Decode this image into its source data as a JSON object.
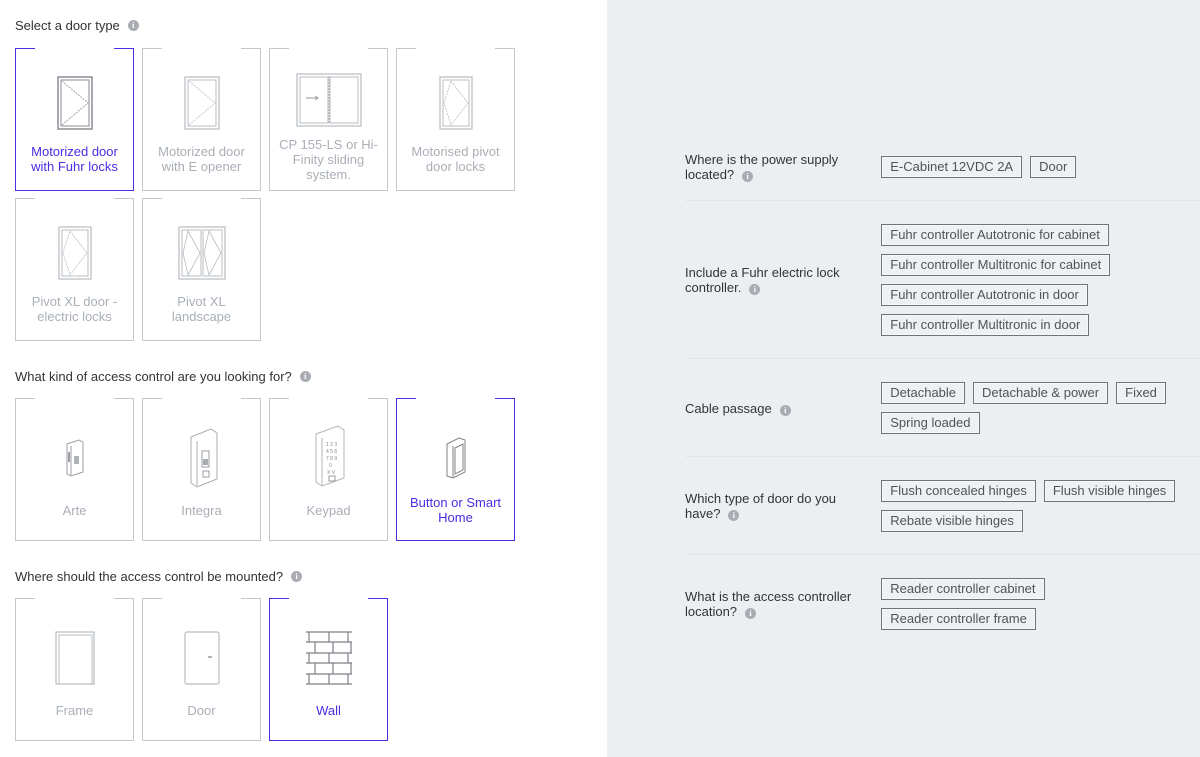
{
  "accent_color": "#4a2de3",
  "left": {
    "door_type": {
      "title": "Select a door type",
      "options": [
        {
          "label": "Motorized door with Fuhr locks",
          "icon": "door-single-icon",
          "selected": true
        },
        {
          "label": "Motorized door with E opener",
          "icon": "door-single-icon",
          "selected": false
        },
        {
          "label": "CP 155-LS or Hi-Finity sliding system.",
          "icon": "sliding-door-icon",
          "selected": false
        },
        {
          "label": "Motorised pivot door locks",
          "icon": "pivot-door-icon",
          "selected": false
        },
        {
          "label": "Pivot XL door - electric locks",
          "icon": "pivot-door-icon",
          "selected": false
        },
        {
          "label": "Pivot XL landscape",
          "icon": "double-pivot-door-icon",
          "selected": false
        }
      ]
    },
    "access_control": {
      "title": "What kind of access control are you looking for?",
      "options": [
        {
          "label": "Arte",
          "icon": "arte-reader-icon",
          "selected": false
        },
        {
          "label": "Integra",
          "icon": "integra-reader-icon",
          "selected": false
        },
        {
          "label": "Keypad",
          "icon": "keypad-icon",
          "selected": false
        },
        {
          "label": "Button or Smart Home",
          "icon": "button-icon",
          "selected": true
        }
      ]
    },
    "mount": {
      "title": "Where should the access control be mounted?",
      "options": [
        {
          "label": "Frame",
          "icon": "frame-icon",
          "selected": false
        },
        {
          "label": "Door",
          "icon": "door-icon",
          "selected": false
        },
        {
          "label": "Wall",
          "icon": "wall-icon",
          "selected": true
        }
      ]
    }
  },
  "right": {
    "questions": [
      {
        "label": "Where is the power supply located?",
        "options": [
          "E-Cabinet 12VDC 2A",
          "Door"
        ]
      },
      {
        "label": "Include a Fuhr electric lock controller.",
        "options": [
          "Fuhr controller Autotronic for cabinet",
          "Fuhr controller Multitronic for cabinet",
          "Fuhr controller Autotronic in door",
          "Fuhr controller Multitronic in door"
        ]
      },
      {
        "label": "Cable passage",
        "options": [
          "Detachable",
          "Detachable & power",
          "Fixed",
          "Spring loaded"
        ]
      },
      {
        "label": "Which type of door do you have?",
        "options": [
          "Flush concealed hinges",
          "Flush visible hinges",
          "Rebate visible hinges"
        ]
      },
      {
        "label": "What is the access controller location?",
        "options": [
          "Reader controller cabinet",
          "Reader controller frame"
        ]
      }
    ]
  },
  "info_glyph": "i"
}
